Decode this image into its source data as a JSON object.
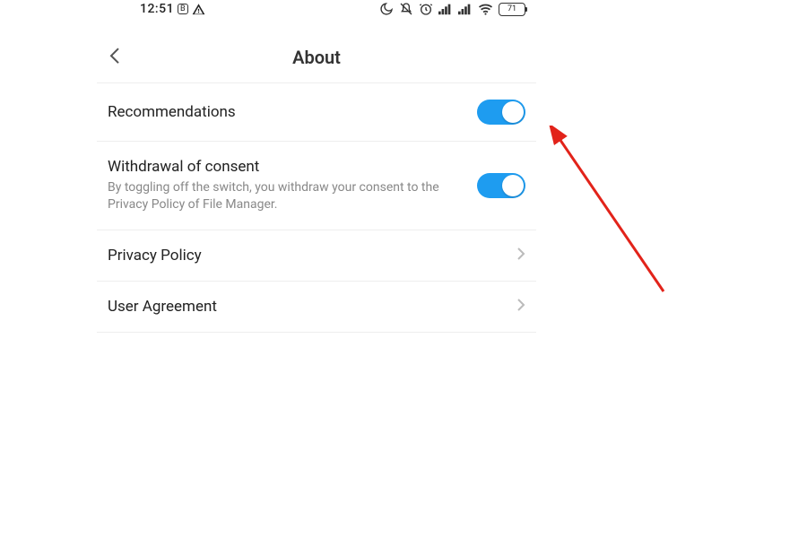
{
  "status": {
    "time": "12:51",
    "battery": "71"
  },
  "header": {
    "title": "About"
  },
  "rows": {
    "recommendations": {
      "title": "Recommendations",
      "on": true
    },
    "consent": {
      "title": "Withdrawal of consent",
      "sub": "By toggling off the switch, you withdraw your consent to the Privacy Policy of File Manager.",
      "on": true
    },
    "privacy": {
      "title": "Privacy Policy"
    },
    "agreement": {
      "title": "User Agreement"
    }
  },
  "annotation": {
    "arrow_color": "#e2231a"
  }
}
